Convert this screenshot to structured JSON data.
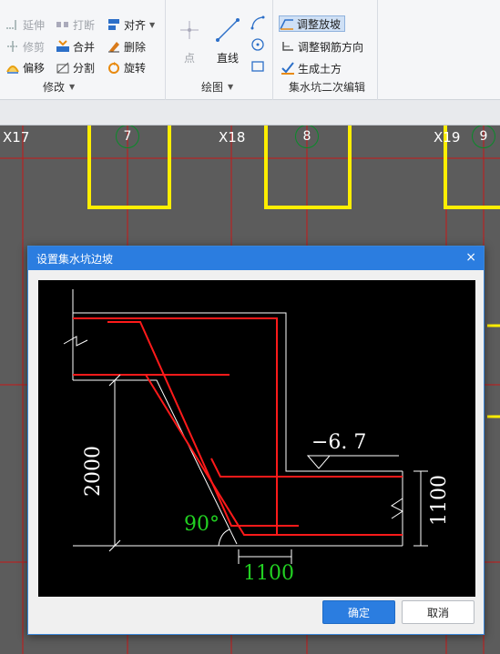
{
  "ribbon": {
    "modify": {
      "items": {
        "extend": "延伸",
        "break": "打断",
        "align": "对齐",
        "trim": "修剪",
        "merge": "合并",
        "delete": "删除",
        "offset": "偏移",
        "split": "分割",
        "rotate": "旋转"
      },
      "label": "修改"
    },
    "draw": {
      "point": "点",
      "line": "直线",
      "label": "绘图"
    },
    "pit": {
      "adjust_slope": "调整放坡",
      "adjust_rebar": "调整钢筋方向",
      "gen_earthwork": "生成土方",
      "label": "集水坑二次编辑"
    }
  },
  "canvas": {
    "grid_labels": [
      "X17",
      "X18",
      "X19"
    ],
    "axis_numbers": [
      "7",
      "8",
      "9"
    ]
  },
  "dialog": {
    "title": "设置集水坑边坡",
    "close": "×",
    "ok": "确定",
    "cancel": "取消",
    "figure": {
      "elevation": "−6. 7",
      "depth": "2000",
      "angle": "90°",
      "bottom_width": "1100",
      "side_height": "1100"
    }
  },
  "colors": {
    "accent": "#2b7de0",
    "rebar": "#ff1a1a",
    "dim_green": "#22d022",
    "pit_yellow": "#ffee00"
  }
}
